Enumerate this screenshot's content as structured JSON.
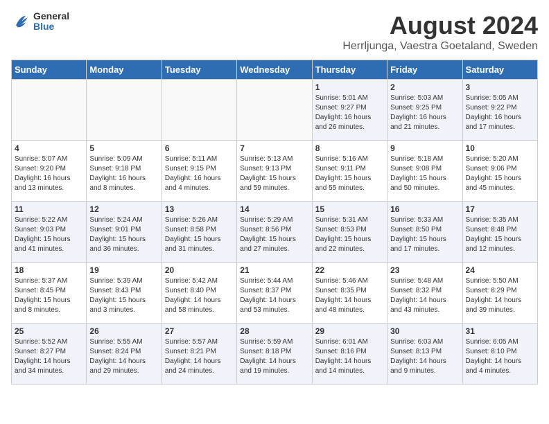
{
  "logo": {
    "general": "General",
    "blue": "Blue"
  },
  "header": {
    "title": "August 2024",
    "subtitle": "Herrljunga, Vaestra Goetaland, Sweden"
  },
  "days_of_week": [
    "Sunday",
    "Monday",
    "Tuesday",
    "Wednesday",
    "Thursday",
    "Friday",
    "Saturday"
  ],
  "weeks": [
    [
      {
        "day": "",
        "content": ""
      },
      {
        "day": "",
        "content": ""
      },
      {
        "day": "",
        "content": ""
      },
      {
        "day": "",
        "content": ""
      },
      {
        "day": "1",
        "content": "Sunrise: 5:01 AM\nSunset: 9:27 PM\nDaylight: 16 hours\nand 26 minutes."
      },
      {
        "day": "2",
        "content": "Sunrise: 5:03 AM\nSunset: 9:25 PM\nDaylight: 16 hours\nand 21 minutes."
      },
      {
        "day": "3",
        "content": "Sunrise: 5:05 AM\nSunset: 9:22 PM\nDaylight: 16 hours\nand 17 minutes."
      }
    ],
    [
      {
        "day": "4",
        "content": "Sunrise: 5:07 AM\nSunset: 9:20 PM\nDaylight: 16 hours\nand 13 minutes."
      },
      {
        "day": "5",
        "content": "Sunrise: 5:09 AM\nSunset: 9:18 PM\nDaylight: 16 hours\nand 8 minutes."
      },
      {
        "day": "6",
        "content": "Sunrise: 5:11 AM\nSunset: 9:15 PM\nDaylight: 16 hours\nand 4 minutes."
      },
      {
        "day": "7",
        "content": "Sunrise: 5:13 AM\nSunset: 9:13 PM\nDaylight: 15 hours\nand 59 minutes."
      },
      {
        "day": "8",
        "content": "Sunrise: 5:16 AM\nSunset: 9:11 PM\nDaylight: 15 hours\nand 55 minutes."
      },
      {
        "day": "9",
        "content": "Sunrise: 5:18 AM\nSunset: 9:08 PM\nDaylight: 15 hours\nand 50 minutes."
      },
      {
        "day": "10",
        "content": "Sunrise: 5:20 AM\nSunset: 9:06 PM\nDaylight: 15 hours\nand 45 minutes."
      }
    ],
    [
      {
        "day": "11",
        "content": "Sunrise: 5:22 AM\nSunset: 9:03 PM\nDaylight: 15 hours\nand 41 minutes."
      },
      {
        "day": "12",
        "content": "Sunrise: 5:24 AM\nSunset: 9:01 PM\nDaylight: 15 hours\nand 36 minutes."
      },
      {
        "day": "13",
        "content": "Sunrise: 5:26 AM\nSunset: 8:58 PM\nDaylight: 15 hours\nand 31 minutes."
      },
      {
        "day": "14",
        "content": "Sunrise: 5:29 AM\nSunset: 8:56 PM\nDaylight: 15 hours\nand 27 minutes."
      },
      {
        "day": "15",
        "content": "Sunrise: 5:31 AM\nSunset: 8:53 PM\nDaylight: 15 hours\nand 22 minutes."
      },
      {
        "day": "16",
        "content": "Sunrise: 5:33 AM\nSunset: 8:50 PM\nDaylight: 15 hours\nand 17 minutes."
      },
      {
        "day": "17",
        "content": "Sunrise: 5:35 AM\nSunset: 8:48 PM\nDaylight: 15 hours\nand 12 minutes."
      }
    ],
    [
      {
        "day": "18",
        "content": "Sunrise: 5:37 AM\nSunset: 8:45 PM\nDaylight: 15 hours\nand 8 minutes."
      },
      {
        "day": "19",
        "content": "Sunrise: 5:39 AM\nSunset: 8:43 PM\nDaylight: 15 hours\nand 3 minutes."
      },
      {
        "day": "20",
        "content": "Sunrise: 5:42 AM\nSunset: 8:40 PM\nDaylight: 14 hours\nand 58 minutes."
      },
      {
        "day": "21",
        "content": "Sunrise: 5:44 AM\nSunset: 8:37 PM\nDaylight: 14 hours\nand 53 minutes."
      },
      {
        "day": "22",
        "content": "Sunrise: 5:46 AM\nSunset: 8:35 PM\nDaylight: 14 hours\nand 48 minutes."
      },
      {
        "day": "23",
        "content": "Sunrise: 5:48 AM\nSunset: 8:32 PM\nDaylight: 14 hours\nand 43 minutes."
      },
      {
        "day": "24",
        "content": "Sunrise: 5:50 AM\nSunset: 8:29 PM\nDaylight: 14 hours\nand 39 minutes."
      }
    ],
    [
      {
        "day": "25",
        "content": "Sunrise: 5:52 AM\nSunset: 8:27 PM\nDaylight: 14 hours\nand 34 minutes."
      },
      {
        "day": "26",
        "content": "Sunrise: 5:55 AM\nSunset: 8:24 PM\nDaylight: 14 hours\nand 29 minutes."
      },
      {
        "day": "27",
        "content": "Sunrise: 5:57 AM\nSunset: 8:21 PM\nDaylight: 14 hours\nand 24 minutes."
      },
      {
        "day": "28",
        "content": "Sunrise: 5:59 AM\nSunset: 8:18 PM\nDaylight: 14 hours\nand 19 minutes."
      },
      {
        "day": "29",
        "content": "Sunrise: 6:01 AM\nSunset: 8:16 PM\nDaylight: 14 hours\nand 14 minutes."
      },
      {
        "day": "30",
        "content": "Sunrise: 6:03 AM\nSunset: 8:13 PM\nDaylight: 14 hours\nand 9 minutes."
      },
      {
        "day": "31",
        "content": "Sunrise: 6:05 AM\nSunset: 8:10 PM\nDaylight: 14 hours\nand 4 minutes."
      }
    ]
  ]
}
